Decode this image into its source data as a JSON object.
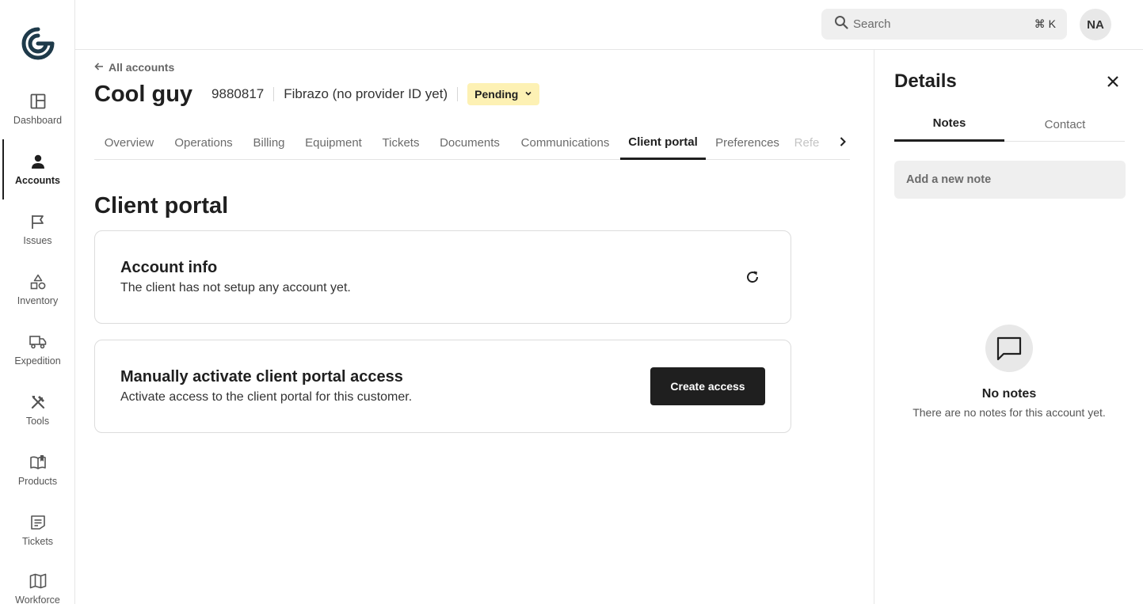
{
  "sidebar": {
    "items": [
      {
        "label": "Dashboard",
        "icon": "dashboard-icon"
      },
      {
        "label": "Accounts",
        "icon": "person-icon",
        "active": true
      },
      {
        "label": "Issues",
        "icon": "flag-icon"
      },
      {
        "label": "Inventory",
        "icon": "shapes-icon"
      },
      {
        "label": "Expedition",
        "icon": "truck-icon"
      },
      {
        "label": "Tools",
        "icon": "tools-icon"
      },
      {
        "label": "Products",
        "icon": "book-icon"
      },
      {
        "label": "Tickets",
        "icon": "ticket-icon"
      },
      {
        "label": "Workforce",
        "icon": "map-icon"
      }
    ]
  },
  "topbar": {
    "search_placeholder": "Search",
    "search_shortcut": "⌘ K",
    "avatar_initials": "NA"
  },
  "header": {
    "back_label": "All accounts",
    "account_name": "Cool guy",
    "account_number": "9880817",
    "provider": "Fibrazo (no provider ID yet)",
    "status": "Pending"
  },
  "tabs": [
    {
      "label": "Overview"
    },
    {
      "label": "Operations"
    },
    {
      "label": "Billing"
    },
    {
      "label": "Equipment"
    },
    {
      "label": "Tickets"
    },
    {
      "label": "Documents"
    },
    {
      "label": "Communications"
    },
    {
      "label": "Client portal",
      "active": true
    },
    {
      "label": "Preferences"
    },
    {
      "label": "Refe"
    }
  ],
  "main": {
    "section_title": "Client portal",
    "account_info": {
      "title": "Account info",
      "description": "The client has not setup any account yet."
    },
    "activate": {
      "title": "Manually activate client portal access",
      "description": "Activate access to the client portal for this customer.",
      "button_label": "Create access"
    }
  },
  "details": {
    "title": "Details",
    "tabs": [
      {
        "label": "Notes",
        "active": true
      },
      {
        "label": "Contact"
      }
    ],
    "note_placeholder": "Add a new note",
    "empty_title": "No notes",
    "empty_description": "There are no notes for this account yet."
  },
  "colors": {
    "accent": "#1f1f1f",
    "status_badge_bg": "#fdf1b4",
    "logo": "#1e3a4a"
  }
}
